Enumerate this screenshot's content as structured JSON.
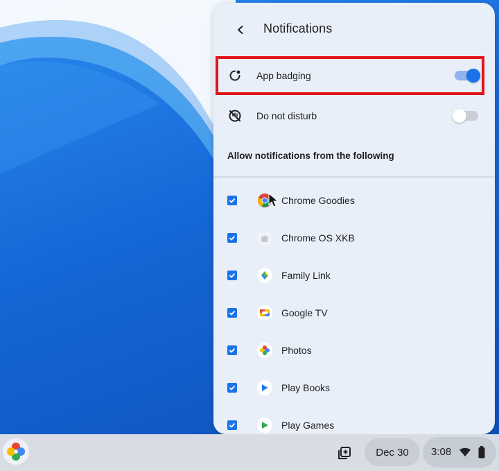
{
  "panel": {
    "title": "Notifications",
    "back_icon": "chevron-left-icon"
  },
  "settings": {
    "app_badging": {
      "label": "App badging",
      "icon": "badge-icon",
      "enabled": true
    },
    "do_not_disturb": {
      "label": "Do not disturb",
      "icon": "do-not-disturb-icon",
      "enabled": false
    }
  },
  "apps_section": {
    "label": "Allow notifications from the following",
    "apps": [
      {
        "name": "Chrome Goodies",
        "checked": true,
        "icon": "chrome-icon"
      },
      {
        "name": "Chrome OS XKB",
        "checked": true,
        "icon": "puzzle-icon"
      },
      {
        "name": "Family Link",
        "checked": true,
        "icon": "family-link-icon"
      },
      {
        "name": "Google TV",
        "checked": true,
        "icon": "google-tv-icon"
      },
      {
        "name": "Photos",
        "checked": true,
        "icon": "photos-icon"
      },
      {
        "name": "Play Books",
        "checked": true,
        "icon": "play-books-icon"
      },
      {
        "name": "Play Games",
        "checked": true,
        "icon": "play-games-icon"
      }
    ]
  },
  "shelf": {
    "date": "Dec 30",
    "time": "3:08"
  },
  "colors": {
    "accent": "#1a73e8",
    "highlight": "#e3141b",
    "panel_bg": "#e9eff8"
  }
}
